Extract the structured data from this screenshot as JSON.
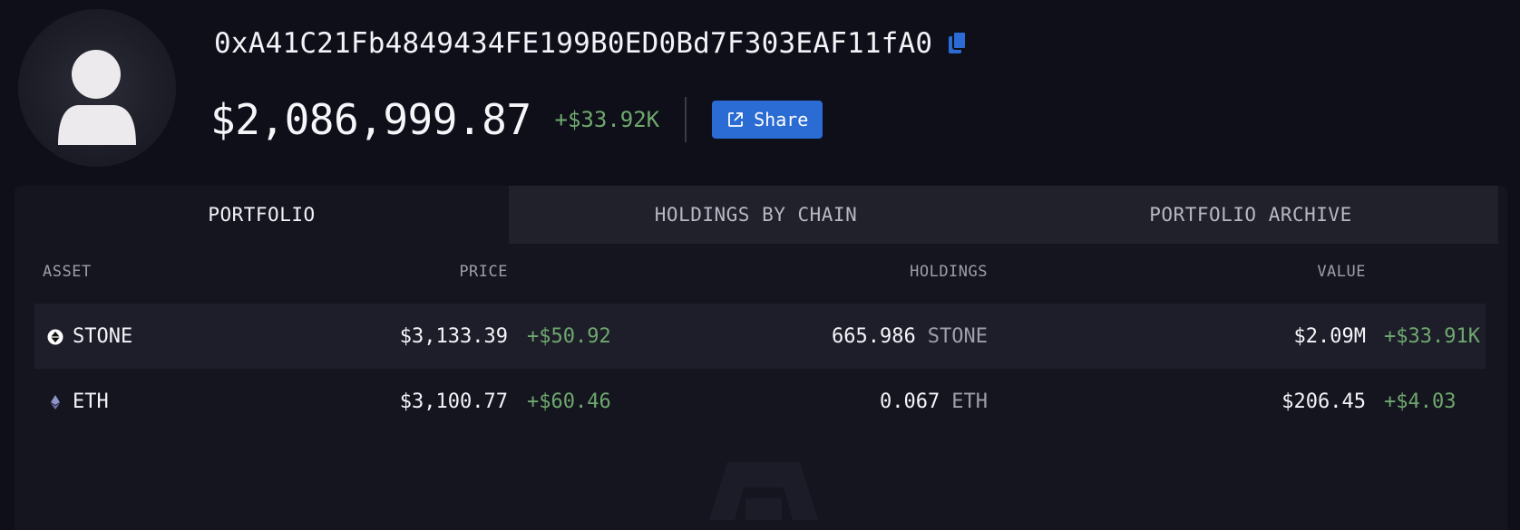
{
  "profile": {
    "address": "0xA41C21Fb4849434FE199B0ED0Bd7F303EAF11fA0",
    "avatar_icon": "user-silhouette-icon",
    "copy_icon": "copy-icon"
  },
  "summary": {
    "total_value": "$2,086,999.87",
    "change": "+$33.92K",
    "share_label": "Share",
    "share_icon": "external-link-icon"
  },
  "tabs": [
    {
      "label": "PORTFOLIO",
      "active": true
    },
    {
      "label": "HOLDINGS BY CHAIN",
      "active": false
    },
    {
      "label": "PORTFOLIO ARCHIVE",
      "active": false
    }
  ],
  "table": {
    "headers": {
      "asset": "ASSET",
      "price": "PRICE",
      "holdings": "HOLDINGS",
      "value": "VALUE"
    },
    "rows": [
      {
        "asset": "STONE",
        "icon": "stone-token-icon",
        "price": "$3,133.39",
        "price_change": "+$50.92",
        "amount": "665.986",
        "unit": "STONE",
        "value": "$2.09M",
        "value_change": "+$33.91K"
      },
      {
        "asset": "ETH",
        "icon": "eth-token-icon",
        "price": "$3,100.77",
        "price_change": "+$60.46",
        "amount": "0.067",
        "unit": "ETH",
        "value": "$206.45",
        "value_change": "+$4.03"
      }
    ]
  },
  "colors": {
    "background": "#0e0f19",
    "card": "#14151f",
    "accent": "#2a6bd4",
    "positive": "#6fa86e"
  }
}
